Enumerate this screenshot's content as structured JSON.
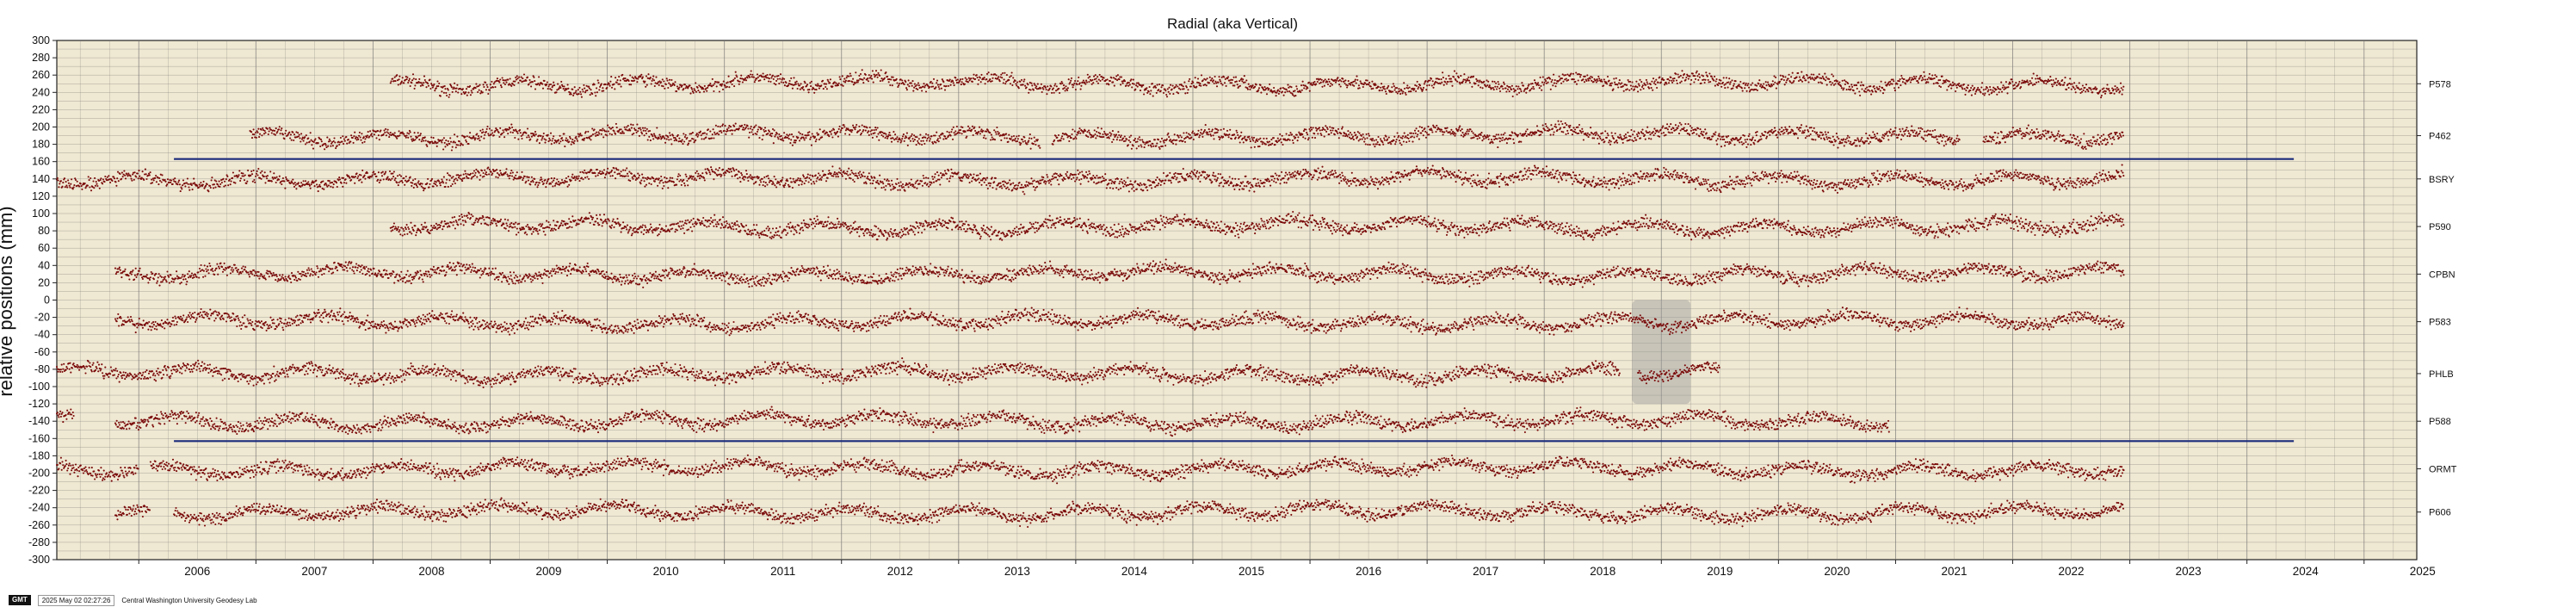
{
  "chart_data": {
    "type": "scatter",
    "title": "Radial (aka Vertical)",
    "ylabel": "relative positions (mm)",
    "xlabel": "",
    "xlim": [
      2005.3,
      2025.45
    ],
    "ylim": [
      -300,
      300
    ],
    "grid": true,
    "colors": {
      "background": "#efe8d2",
      "points": "#7a0a0a",
      "reference_lines": "#1a2a7a",
      "grid": "#707070",
      "shading": "#9a9a9a"
    },
    "x_ticks": [
      "2006",
      "2007",
      "2008",
      "2009",
      "2010",
      "2011",
      "2012",
      "2013",
      "2014",
      "2015",
      "2016",
      "2017",
      "2018",
      "2019",
      "2020",
      "2021",
      "2022",
      "2023",
      "2024",
      "2025"
    ],
    "y_ticks": [
      "300",
      "280",
      "260",
      "240",
      "220",
      "200",
      "180",
      "160",
      "140",
      "120",
      "100",
      "80",
      "60",
      "40",
      "20",
      "0",
      "-20",
      "-40",
      "-60",
      "-80",
      "-100",
      "-120",
      "-140",
      "-160",
      "-180",
      "-200",
      "-220",
      "-240",
      "-260",
      "-280",
      "-300"
    ],
    "series": [
      {
        "name": "P578",
        "offset": 250,
        "segments": [
          [
            2008.15,
            2022.95
          ]
        ]
      },
      {
        "name": "P462",
        "offset": 190,
        "segments": [
          [
            2006.95,
            2013.7
          ],
          [
            2013.8,
            2021.55
          ],
          [
            2021.75,
            2022.95
          ]
        ]
      },
      {
        "name": "BSRY",
        "offset": 140,
        "segments": [
          [
            2005.3,
            2022.95
          ]
        ]
      },
      {
        "name": "P590",
        "offset": 85,
        "segments": [
          [
            2008.15,
            2022.95
          ]
        ]
      },
      {
        "name": "CPBN",
        "offset": 30,
        "segments": [
          [
            2005.8,
            2022.95
          ]
        ]
      },
      {
        "name": "P583",
        "offset": -25,
        "segments": [
          [
            2005.8,
            2022.95
          ]
        ]
      },
      {
        "name": "PHLB",
        "offset": -85,
        "segments": [
          [
            2005.3,
            2018.65
          ],
          [
            2018.8,
            2019.5
          ]
        ]
      },
      {
        "name": "P588",
        "offset": -140,
        "segments": [
          [
            2005.3,
            2005.45
          ],
          [
            2005.8,
            2020.95
          ]
        ]
      },
      {
        "name": "ORMT",
        "offset": -195,
        "segments": [
          [
            2005.3,
            2006.0
          ],
          [
            2006.1,
            2022.95
          ]
        ]
      },
      {
        "name": "P606",
        "offset": -245,
        "segments": [
          [
            2005.8,
            2006.1
          ],
          [
            2006.3,
            2022.95
          ]
        ]
      }
    ],
    "reference_lines": [
      {
        "y": 163,
        "x": [
          2006.3,
          2024.4
        ]
      },
      {
        "y": -163,
        "x": [
          2006.3,
          2024.4
        ]
      }
    ],
    "shaded_region": {
      "x": [
        2018.75,
        2019.25
      ],
      "y": [
        -120,
        0
      ]
    }
  },
  "footer": {
    "logo": "GMT",
    "timestamp": "2025 May 02 02:27:26",
    "credit": "Central Washington University Geodesy Lab"
  }
}
